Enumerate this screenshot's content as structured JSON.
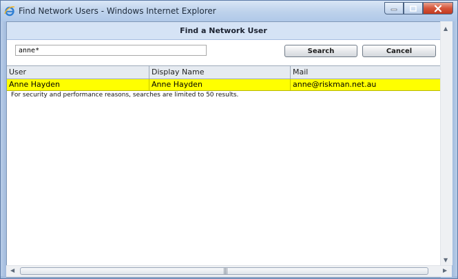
{
  "window": {
    "title": "Find Network Users - Windows Internet Explorer",
    "icons": {
      "app": "ie-logo-icon",
      "minimize": "minimize-icon",
      "maximize": "maximize-icon",
      "close": "close-icon"
    }
  },
  "form": {
    "header": "Find a Network User",
    "search_value": "anne*",
    "search_label": "Search",
    "cancel_label": "Cancel"
  },
  "table": {
    "columns": [
      "User",
      "Display Name",
      "Mail"
    ],
    "rows": [
      {
        "user": "Anne Hayden",
        "display_name": "Anne Hayden",
        "mail": "anne@riskman.net.au",
        "highlight_color": "#ffff00"
      }
    ]
  },
  "notice": "For security and performance reasons, searches are limited to 50 results.",
  "scrollbar": {
    "up_icon": "up-arrow-icon",
    "down_icon": "down-arrow-icon",
    "left_icon": "left-arrow-icon",
    "right_icon": "right-arrow-icon",
    "grip_icon": "scroll-grip-icon"
  },
  "colors": {
    "header_band": "#d5e3f5",
    "selected_row": "#ffff00",
    "close_button": "#c94a30"
  }
}
